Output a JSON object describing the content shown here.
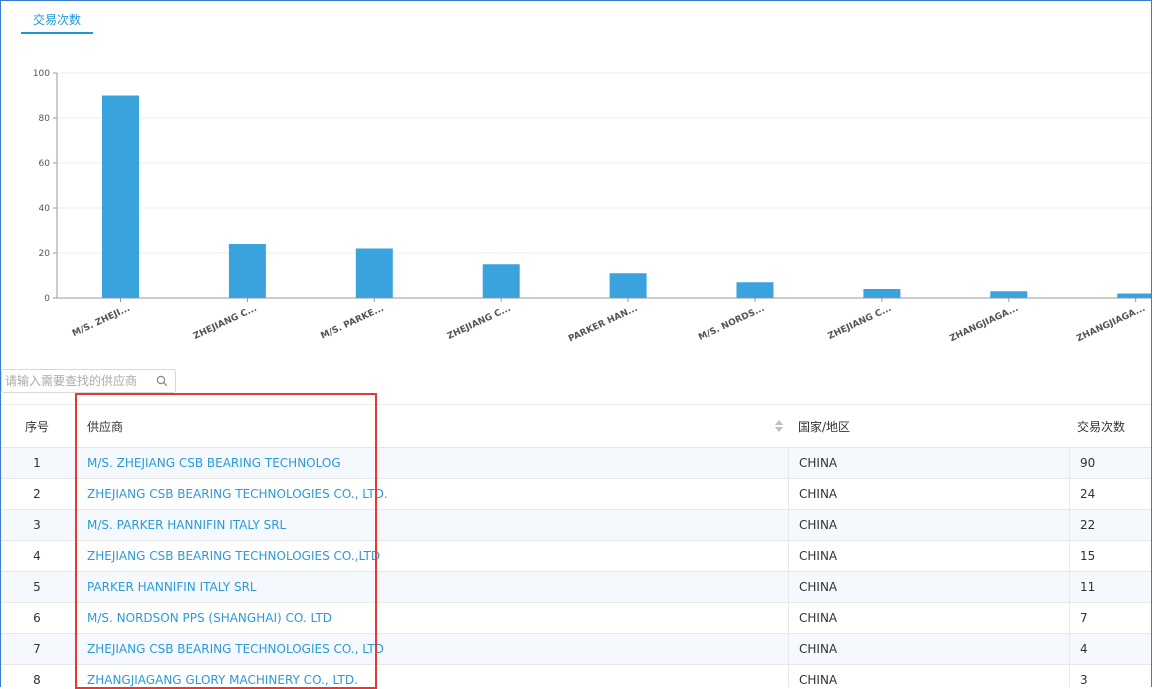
{
  "tab": {
    "label": "交易次数"
  },
  "search": {
    "placeholder": "请输入需要查找的供应商"
  },
  "colors": {
    "accent": "#2196d3",
    "bar": "#3aa3dd",
    "link": "#2a9bd8",
    "highlight": "#e53935"
  },
  "chart_data": {
    "type": "bar",
    "categories": [
      "M/S. ZHEJI...",
      "ZHEJIANG C...",
      "M/S. PARKE...",
      "ZHEJIANG C...",
      "PARKER HAN...",
      "M/S. NORDS...",
      "ZHEJIANG C...",
      "ZHANGJIAGA...",
      "ZHANGJIAGA..."
    ],
    "values": [
      90,
      24,
      22,
      15,
      11,
      7,
      4,
      3,
      2
    ],
    "yticks": [
      0,
      20,
      40,
      60,
      80,
      100
    ],
    "ylim": [
      0,
      100
    ],
    "grid": true
  },
  "table": {
    "headers": {
      "index": "序号",
      "supplier": "供应商",
      "country": "国家/地区",
      "count": "交易次数"
    },
    "rows": [
      {
        "index": "1",
        "supplier": "M/S. ZHEJIANG CSB BEARING TECHNOLOG",
        "country": "CHINA",
        "count": "90"
      },
      {
        "index": "2",
        "supplier": "ZHEJIANG CSB BEARING TECHNOLOGIES CO., LTD.",
        "country": "CHINA",
        "count": "24"
      },
      {
        "index": "3",
        "supplier": "M/S. PARKER HANNIFIN ITALY SRL",
        "country": "CHINA",
        "count": "22"
      },
      {
        "index": "4",
        "supplier": "ZHEJIANG CSB BEARING TECHNOLOGIES CO.,LTD",
        "country": "CHINA",
        "count": "15"
      },
      {
        "index": "5",
        "supplier": "PARKER HANNIFIN ITALY SRL",
        "country": "CHINA",
        "count": "11"
      },
      {
        "index": "6",
        "supplier": "M/S. NORDSON PPS (SHANGHAI) CO. LTD",
        "country": "CHINA",
        "count": "7"
      },
      {
        "index": "7",
        "supplier": "ZHEJIANG CSB BEARING TECHNOLOGIES CO., LTD",
        "country": "CHINA",
        "count": "4"
      },
      {
        "index": "8",
        "supplier": "ZHANGJIAGANG GLORY MACHINERY CO., LTD.",
        "country": "CHINA",
        "count": "3"
      }
    ]
  }
}
